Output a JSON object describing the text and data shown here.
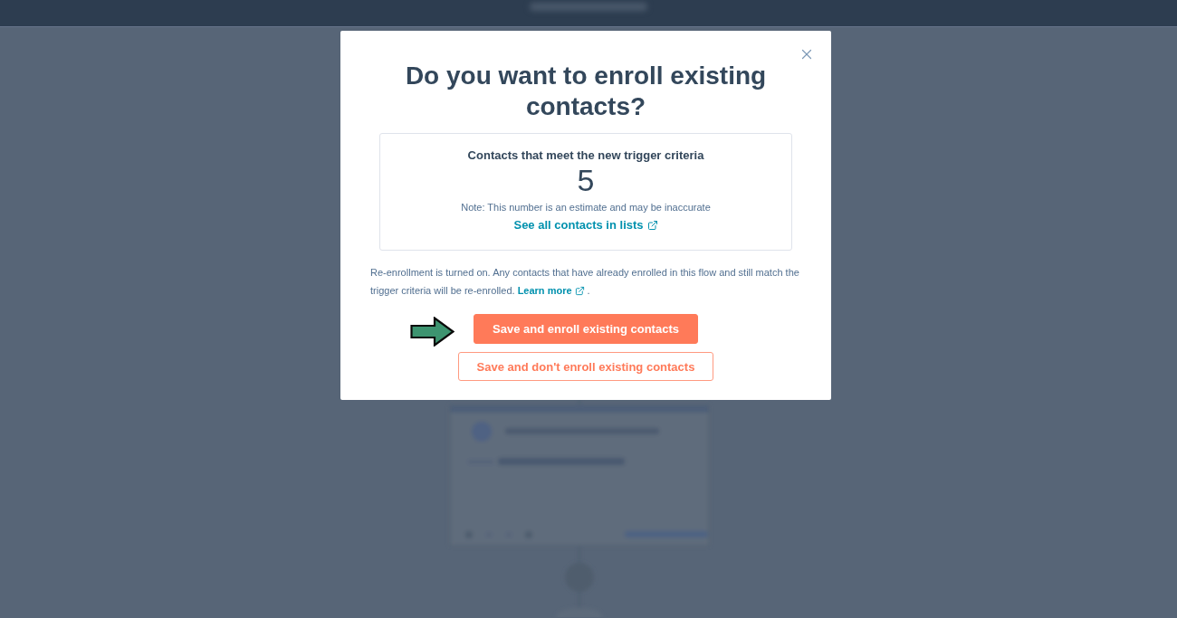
{
  "modal": {
    "title": "Do you want to enroll existing contacts?",
    "estimate": {
      "heading": "Contacts that meet the new trigger criteria",
      "count": "5",
      "note": "Note: This number is an estimate and may be inaccurate",
      "link": "See all contacts in lists"
    },
    "reenrollment_note": {
      "text": "Re-enrollment is turned on. Any contacts that have already enrolled in this flow and still match the trigger criteria will be re-enrolled.",
      "link": "Learn more",
      "trailing": "."
    },
    "buttons": [
      {
        "label": "Save and enroll existing contacts",
        "kind": "primary"
      },
      {
        "label": "Save and don't enroll existing contacts",
        "kind": "secondary"
      }
    ]
  }
}
